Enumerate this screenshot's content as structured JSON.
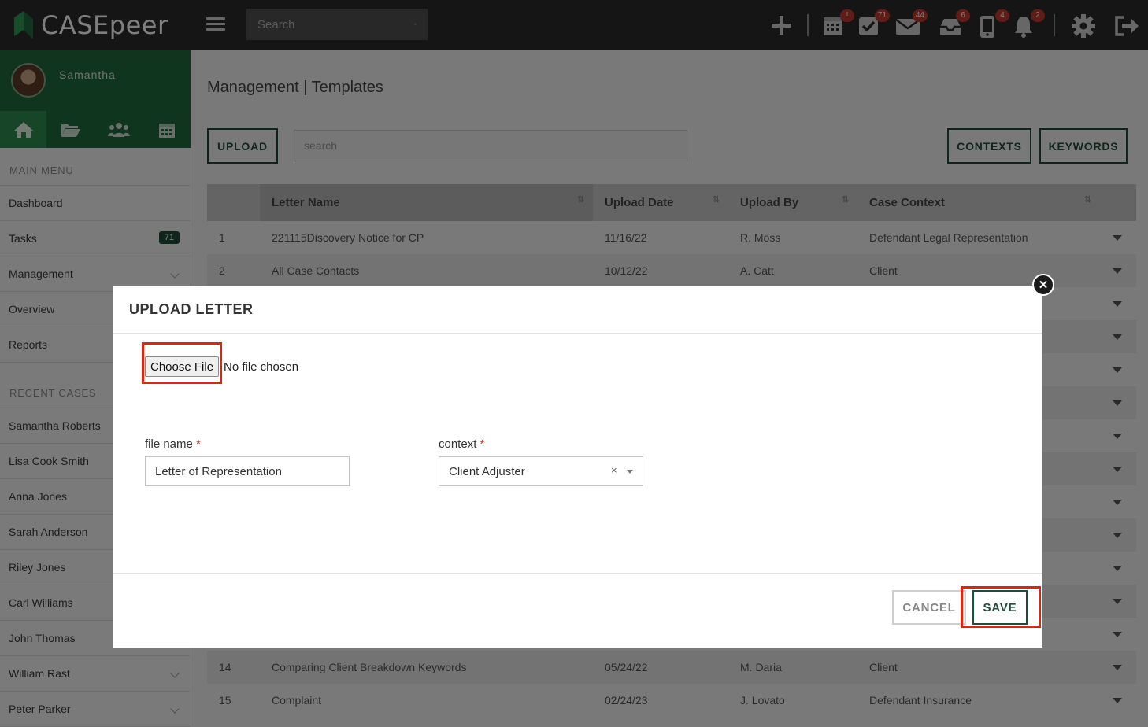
{
  "app": {
    "brand": "CASEpeer",
    "accent": "#1e6b3e"
  },
  "topbar": {
    "search_placeholder": "Search",
    "icons": [
      {
        "name": "add-icon",
        "badge": ""
      },
      {
        "name": "calendar-icon",
        "badge": "!"
      },
      {
        "name": "tasks-icon",
        "badge": "71"
      },
      {
        "name": "mail-icon",
        "badge": "44"
      },
      {
        "name": "inbox-icon",
        "badge": "6"
      },
      {
        "name": "phone-icon",
        "badge": "4"
      },
      {
        "name": "bell-icon",
        "badge": "2"
      },
      {
        "name": "gear-icon",
        "badge": ""
      },
      {
        "name": "logout-icon",
        "badge": ""
      }
    ]
  },
  "sidebar": {
    "user_name": "Samantha",
    "tabs": [
      "home-icon",
      "folder-icon",
      "users-icon",
      "calendar-icon"
    ],
    "main_menu_title": "MAIN MENU",
    "main_menu": [
      {
        "label": "Dashboard"
      },
      {
        "label": "Tasks",
        "badge": "71"
      },
      {
        "label": "Management",
        "chevron": true
      },
      {
        "label": "Overview"
      },
      {
        "label": "Reports"
      }
    ],
    "recent_title": "RECENT CASES",
    "recent_cases": [
      {
        "label": "Samantha Roberts"
      },
      {
        "label": "Lisa Cook Smith"
      },
      {
        "label": "Anna Jones"
      },
      {
        "label": "Sarah Anderson"
      },
      {
        "label": "Riley Jones"
      },
      {
        "label": "Carl Williams"
      },
      {
        "label": "John Thomas"
      },
      {
        "label": "William Rast",
        "chevron": true
      },
      {
        "label": "Peter Parker",
        "chevron": true
      }
    ]
  },
  "main": {
    "title": "Management | Templates",
    "upload_label": "UPLOAD",
    "search_placeholder": "search",
    "contexts_label": "CONTEXTS",
    "keywords_label": "KEYWORDS",
    "columns": [
      "Letter Name",
      "Upload Date",
      "Upload By",
      "Case Context"
    ],
    "rows": [
      {
        "num": "1",
        "name": "221115Discovery Notice for CP",
        "date": "11/16/22",
        "by": "R. Moss",
        "context": "Defendant Legal Representation"
      },
      {
        "num": "2",
        "name": "All Case Contacts",
        "date": "10/12/22",
        "by": "A. Catt",
        "context": "Client"
      }
    ],
    "rows_bottom": [
      {
        "num": "14",
        "name": "Comparing Client Breakdown Keywords",
        "date": "05/24/22",
        "by": "M. Daria",
        "context": "Client"
      },
      {
        "num": "15",
        "name": "Complaint",
        "date": "02/24/23",
        "by": "J. Lovato",
        "context": "Defendant Insurance"
      }
    ]
  },
  "modal": {
    "title": "UPLOAD LETTER",
    "choose_file_label": "Choose File",
    "file_status": "No file chosen",
    "file_name_label": "file name",
    "file_name_value": "Letter of Representation",
    "context_label": "context",
    "context_value": "Client Adjuster",
    "required_mark": "*",
    "clear_symbol": "×",
    "cancel_label": "CANCEL",
    "save_label": "SAVE",
    "close_symbol": "✕"
  }
}
